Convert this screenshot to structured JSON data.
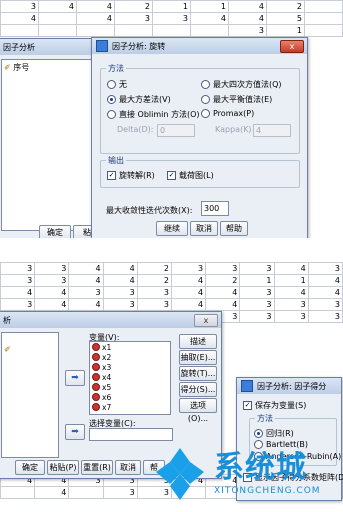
{
  "grid_top": {
    "rows": [
      [
        "3",
        "4",
        "4",
        "2",
        "1",
        "1",
        "4",
        "2"
      ],
      [
        "4",
        "",
        "4",
        "3",
        "3",
        "4",
        "4",
        "5"
      ],
      [
        "",
        "",
        "",
        "",
        "",
        "",
        "3",
        "1"
      ]
    ]
  },
  "grid_bottom": {
    "rows": [
      [
        "3",
        "3",
        "4",
        "4",
        "2",
        "3",
        "3",
        "3",
        "4",
        "3",
        "4"
      ],
      [
        "3",
        "3",
        "4",
        "4",
        "2",
        "4",
        "2",
        "1",
        "1",
        "4",
        "3"
      ],
      [
        "4",
        "4",
        "3",
        "3",
        "3",
        "4",
        "4",
        "3",
        "4",
        "4",
        "4"
      ],
      [
        "3",
        "4",
        "4",
        "3",
        "3",
        "4",
        "4",
        "3",
        "3",
        "3",
        "3"
      ],
      [
        "3",
        "4",
        "4",
        "3",
        "3",
        "3",
        "3",
        "3",
        "3",
        "3",
        "3"
      ]
    ],
    "bottom_rows": [
      [
        "",
        "",
        "",
        "",
        "",
        "",
        "",
        "",
        "",
        "",
        ""
      ],
      [
        "4",
        "4",
        "3",
        "3",
        "5",
        "4",
        "4",
        "4",
        "3",
        "3",
        "3"
      ],
      [
        "",
        "4",
        "",
        "3",
        "3",
        "",
        "",
        "",
        "",
        "3",
        ""
      ]
    ]
  },
  "factor_analysis_bg_top": {
    "title": "因子分析",
    "var_item": "序号",
    "ok": "确定",
    "paste": "粘贴"
  },
  "rotation_dialog": {
    "title": "因子分析: 旋转",
    "method_group": "方法",
    "none": "无",
    "quartimax": "最大四次方值法(Q)",
    "varimax": "最大方差法(V)",
    "equamax": "最大平衡值法(E)",
    "oblimin": "直接 Oblimin 方法(O)",
    "promax": "Promax(P)",
    "delta_label": "Delta(D):",
    "delta_value": "0",
    "kappa_label": "Kappa(K)",
    "kappa_value": "4",
    "output_group": "输出",
    "rotated_solution": "旋转解(R)",
    "loading_plot": "载荷图(L)",
    "max_iter_label": "最大收敛性迭代次数(X):",
    "max_iter_value": "300",
    "continue": "继续",
    "cancel": "取消",
    "help": "帮助",
    "close": "x"
  },
  "factor_analysis_main": {
    "title": "析",
    "close": "x",
    "variables_label": "变量(V):",
    "variables": [
      "x1",
      "x2",
      "x3",
      "x4",
      "x5",
      "x6",
      "x7"
    ],
    "selection_label": "选择变量(C):",
    "side_buttons": [
      "描述(D)...",
      "抽取(E)...",
      "旋转(T)...",
      "得分(S)...",
      "选项(O)..."
    ],
    "bottom_buttons": [
      "确定",
      "粘贴(P)",
      "重置(R)",
      "取消",
      "帮"
    ]
  },
  "scores_dialog": {
    "title": "因子分析: 因子得分",
    "save_as_vars": "保存为变量(S)",
    "method_group": "方法",
    "regression": "回归(R)",
    "bartlett": "Bartlett(B)",
    "anderson": "Anderson-Rubin(A)",
    "display_coef": "显示因子得分系数矩阵(D)"
  },
  "watermark": {
    "brand": "系统城",
    "url": "XITONGCHENG.COM"
  }
}
